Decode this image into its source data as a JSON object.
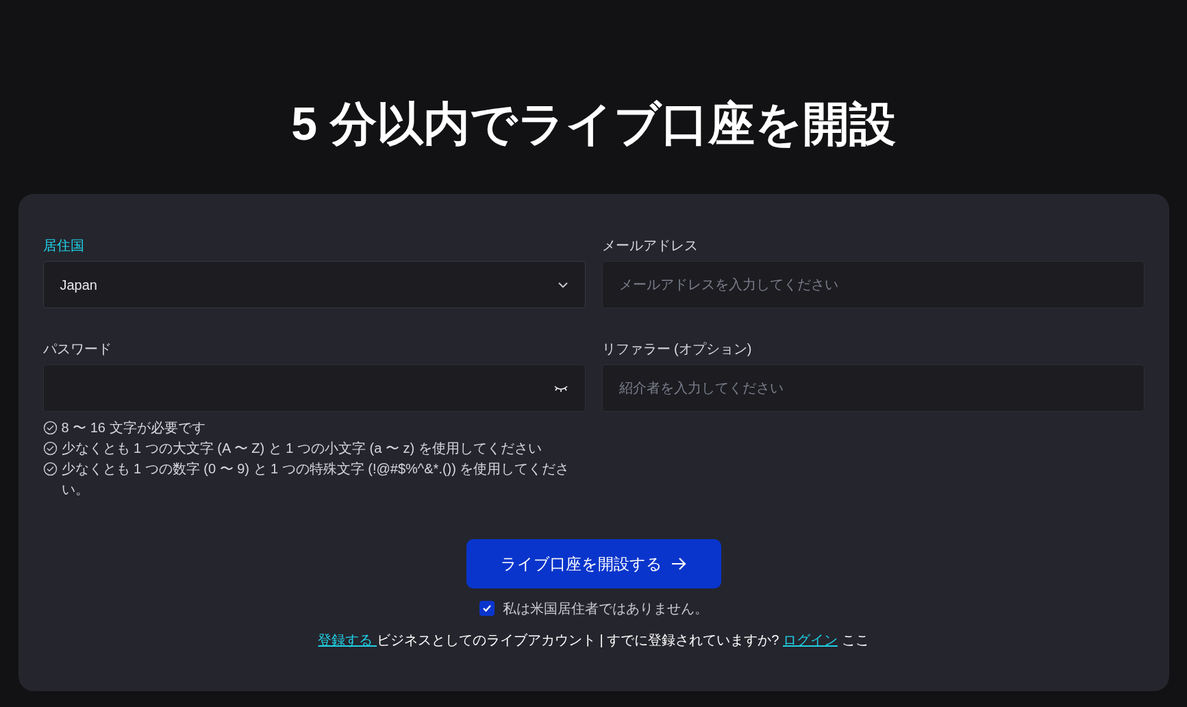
{
  "title": "5 分以内でライブ口座を開設",
  "fields": [
    {
      "kind": "select",
      "label": "居住国",
      "focused": true,
      "value": "Japan"
    },
    {
      "kind": "text",
      "label": "メールアドレス",
      "focused": false,
      "placeholder": "メールアドレスを入力してください"
    },
    {
      "kind": "password",
      "label": "パスワード",
      "focused": false
    },
    {
      "kind": "text",
      "label": "リファラー (オプション)",
      "focused": false,
      "placeholder": "紹介者を入力してください"
    }
  ],
  "password_rules": [
    "8 〜 16 文字が必要です",
    "少なくとも 1 つの大文字 (A 〜 Z) と 1 つの小文字 (a 〜 z) を使用してください",
    "少なくとも 1 つの数字 (0 〜 9) と 1 つの特殊文字 (!@#$%^&*.()) を使用してください。"
  ],
  "submit_button": "ライブ口座を開設する",
  "us_resident_checkbox": {
    "label": "私は米国居住者ではありません。",
    "checked": true
  },
  "footer": [
    {
      "kind": "link",
      "text": "登録する "
    },
    {
      "kind": "text",
      "text": "ビジネスとしてのライブアカウント | すでに登録されていますか? "
    },
    {
      "kind": "link",
      "text": "ログイン"
    },
    {
      "kind": "text",
      "text": " ここ"
    }
  ]
}
